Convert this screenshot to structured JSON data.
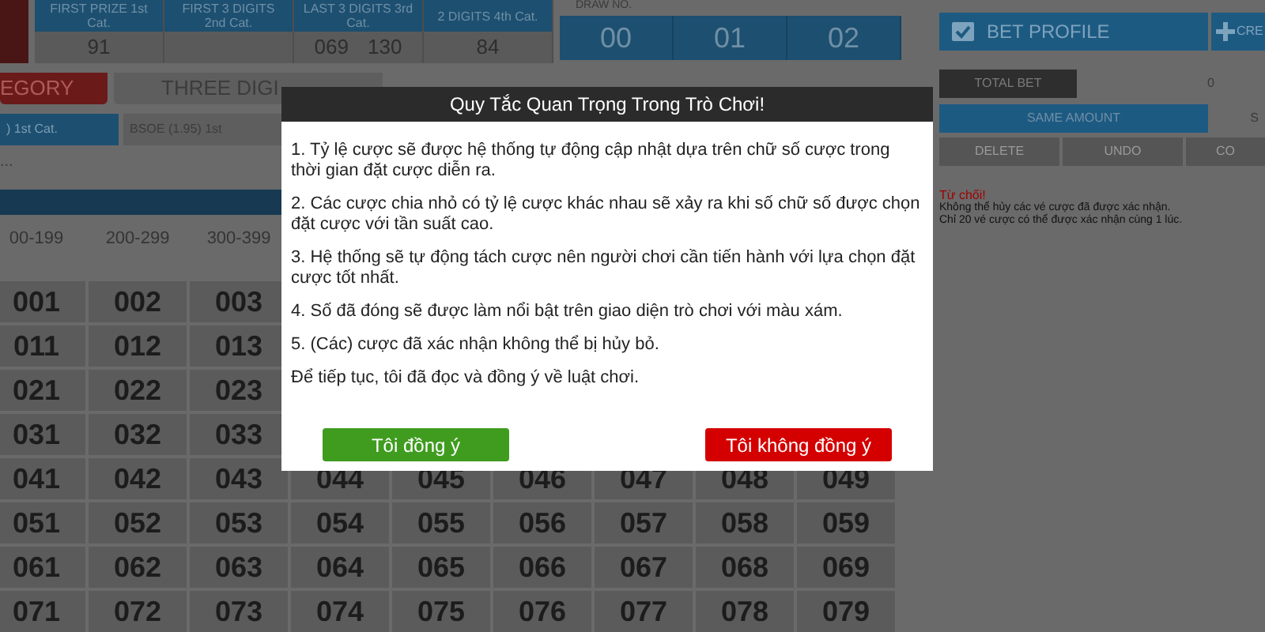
{
  "results": {
    "columns": [
      {
        "heading": "FIRST PRIZE 1st Cat.",
        "values": [
          "91"
        ]
      },
      {
        "heading": "FIRST 3 DIGITS 2nd Cat."
      },
      {
        "heading": "LAST 3 DIGITS 3rd Cat.",
        "values": [
          "069",
          "130"
        ]
      },
      {
        "heading": "2 DIGITS 4th Cat.",
        "values": [
          "84"
        ]
      }
    ]
  },
  "draw": {
    "label": "DRAW NO.",
    "digits": [
      "00",
      "01",
      "02"
    ]
  },
  "category_tabs": [
    {
      "label": "EGORY",
      "selected": true
    },
    {
      "label": "THREE DIGI",
      "selected": false
    }
  ],
  "sub_tabs": [
    {
      "label": ") 1st Cat.",
      "selected": true
    },
    {
      "label": "BSOE (1.95) 1st",
      "selected": false
    }
  ],
  "filter_text": "...",
  "ranges": [
    "00-199",
    "200-299",
    "300-399"
  ],
  "grid": [
    [
      "001",
      "002",
      "003"
    ],
    [
      "011",
      "012",
      "013"
    ],
    [
      "021",
      "022",
      "023"
    ],
    [
      "031",
      "032",
      "033"
    ],
    [
      "041",
      "042",
      "043",
      "044",
      "045",
      "046",
      "047",
      "048",
      "049"
    ],
    [
      "051",
      "052",
      "053",
      "054",
      "055",
      "056",
      "057",
      "058",
      "059"
    ],
    [
      "061",
      "062",
      "063",
      "064",
      "065",
      "066",
      "067",
      "068",
      "069"
    ],
    [
      "071",
      "072",
      "073",
      "074",
      "075",
      "076",
      "077",
      "078",
      "079"
    ]
  ],
  "bet_panel": {
    "profile": "BET PROFILE",
    "create": "CRE",
    "total_label": "TOTAL BET",
    "total_value": "0",
    "same_amount": "SAME AMOUNT",
    "same_other": "S",
    "actions": [
      "DELETE",
      "UNDO",
      "CO"
    ],
    "notice_title": "Từ chối!",
    "notice_lines": [
      "Không thể hủy các vé cược đã được xác nhận.",
      "Chỉ 20 vé cược có thể được xác nhận cùng 1 lúc."
    ]
  },
  "modal": {
    "title": "Quy Tắc Quan Trọng Trong Trò Chơi!",
    "rules": [
      "1. Tỷ lệ cược sẽ được hệ thống tự động cập nhật dựa trên chữ số cược trong thời gian đặt cược diễn ra.",
      "2. Các cược chia nhỏ có tỷ lệ cược khác nhau sẽ xảy ra khi số chữ số được chọn đặt cược với tần suất cao.",
      "3. Hệ thống sẽ tự động tách cược nên người chơi cần tiến hành với lựa chọn đặt cược tốt nhất.",
      "4. Số đã đóng sẽ được làm nổi bật trên giao diện trò chơi với màu xám.",
      "5. (Các) cược đã xác nhận không thể bị hủy bỏ.",
      "Để tiếp tục, tôi đã đọc và đồng ý về luật chơi."
    ],
    "buttons": [
      {
        "label": "Tôi đồng ý",
        "kind": "accept"
      },
      {
        "label": "Tôi không đồng ý",
        "kind": "decline"
      }
    ]
  }
}
